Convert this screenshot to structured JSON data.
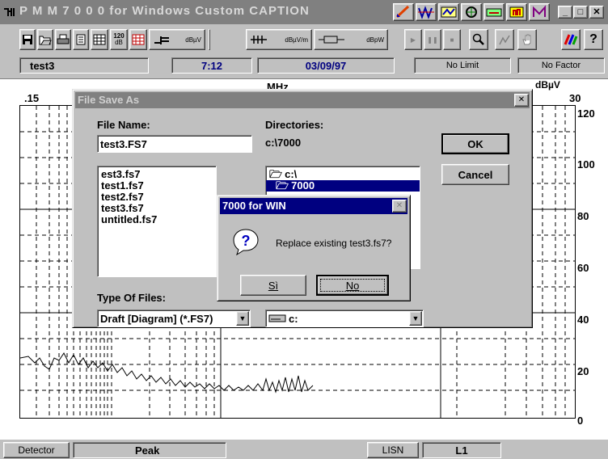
{
  "window": {
    "title": "P M M    7 0 0 0   for  Windows  Custom CAPTION",
    "controls": [
      "_",
      "□",
      "✕"
    ]
  },
  "toolbar": {
    "units_1": "dBµV",
    "units_2": "dBµV/m",
    "units_3": "dBpW",
    "level_120": "120",
    "level_db": "dB"
  },
  "info": {
    "file": "test3",
    "time": "7:12",
    "date": "03/09/97",
    "limit": "No Limit",
    "factor": "No Factor"
  },
  "plot": {
    "freq_start": ".15",
    "freq_unit": "MHz",
    "freq_end": "30",
    "y_unit": "dBµV",
    "y_ticks": [
      "120",
      "100",
      "80",
      "60",
      "40",
      "20",
      "0"
    ]
  },
  "save_dialog": {
    "title": "File Save As",
    "file_name_label": "File Name:",
    "file_name_value": "test3.FS7",
    "directories_label": "Directories:",
    "current_dir": "c:\\7000",
    "files": [
      "est3.fs7",
      "test1.fs7",
      "test2.fs7",
      "test3.fs7",
      "untitled.fs7"
    ],
    "dirs": [
      "c:\\",
      "7000"
    ],
    "type_label": "Type Of Files:",
    "type_value": "Draft [Diagram]  (*.FS7)",
    "drive_value": "c:",
    "ok_label": "OK",
    "cancel_label": "Cancel"
  },
  "confirm_dialog": {
    "title": "7000 for WIN",
    "message": "Replace existing test3.fs7?",
    "yes_label": "Sì",
    "no_label": "No"
  },
  "status": {
    "detector_label": "Detector",
    "detector_value": "Peak",
    "lisn_label": "LISN",
    "lisn_value": "L1"
  }
}
